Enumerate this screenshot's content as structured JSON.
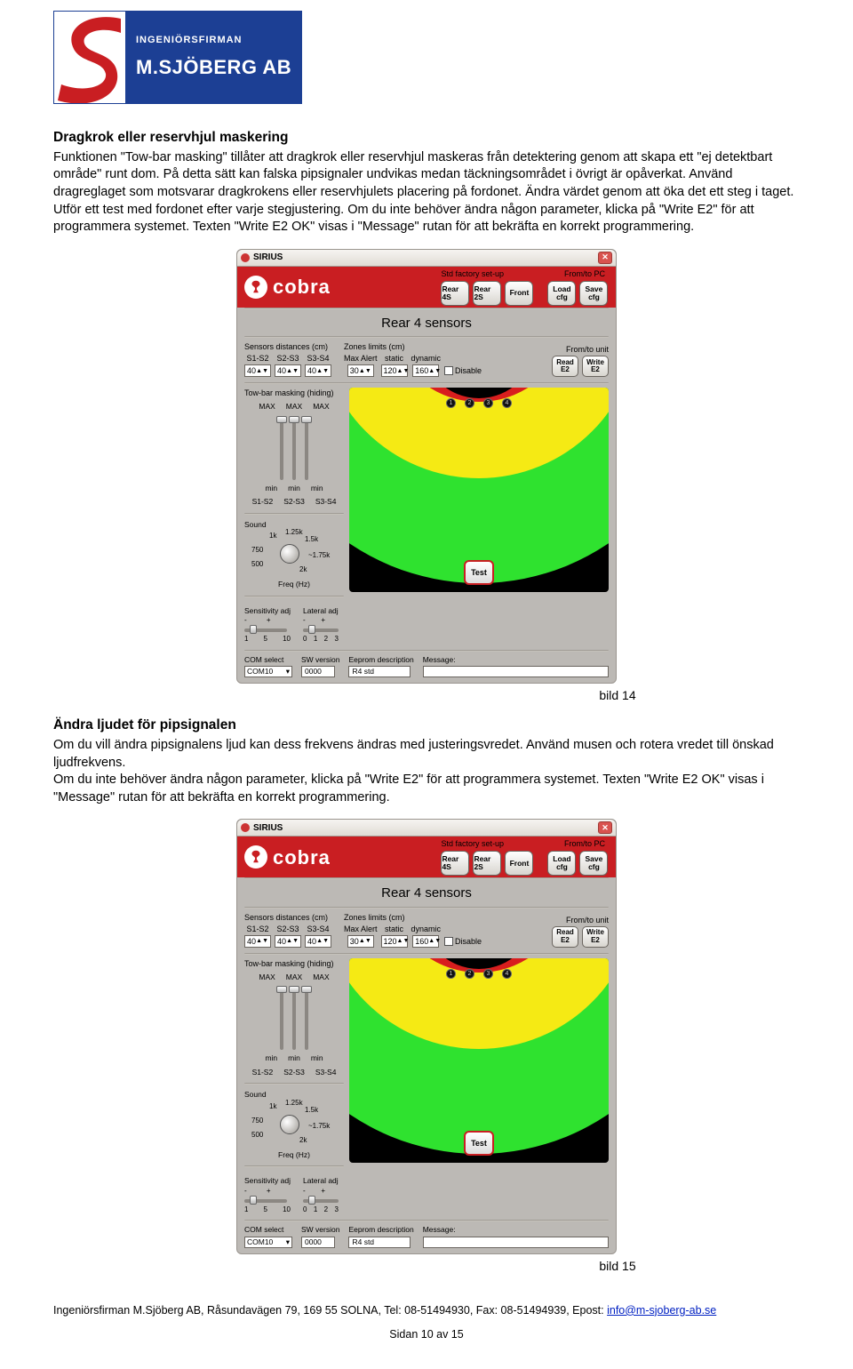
{
  "logo": {
    "small": "INGENIÖRSFIRMAN",
    "big": "M.SJÖBERG AB"
  },
  "sec1": {
    "head": "Dragkrok eller reservhjul maskering",
    "body": "Funktionen \"Tow-bar masking\" tillåter att dragkrok eller reservhjul maskeras från detektering genom att skapa ett \"ej detektbart område\" runt dom. På detta sätt kan falska pipsignaler undvikas medan täckningsområdet i övrigt är opåverkat. Använd dragreglaget som motsvarar dragkrokens eller reservhjulets placering på fordonet. Ändra värdet genom att öka det ett steg i taget. Utför ett test med fordonet efter varje stegjustering. Om du inte behöver ändra någon parameter, klicka på \"Write E2\" för att programmera systemet. Texten \"Write E2 OK\" visas i \"Message\" rutan för att bekräfta en korrekt programmering."
  },
  "caption1": "bild 14",
  "sec2": {
    "head": "Ändra ljudet för pipsignalen",
    "body1": "Om du vill ändra pipsignalens ljud kan dess frekvens ändras med justeringsvredet. Använd musen och rotera vredet till önskad ljudfrekvens.",
    "body2": "Om du inte behöver ändra någon parameter, klicka på \"Write E2\" för att programmera systemet. Texten \"Write E2 OK\" visas i \"Message\" rutan för att bekräfta en korrekt programmering."
  },
  "caption2": "bild 15",
  "app": {
    "title": "SIRIUS",
    "bannerLblLeft": "Std factory set-up",
    "bannerLblRight": "From/to PC",
    "btns": {
      "rear4s": "Rear 4S",
      "rear2s": "Rear 2S",
      "front": "Front",
      "loadcfg1": "Load",
      "loadcfg2": "cfg",
      "savecfg1": "Save",
      "savecfg2": "cfg"
    },
    "bigtitle": "Rear 4 sensors",
    "groups": {
      "dist": "Sensors distances (cm)",
      "zones": "Zones limits (cm)",
      "unit": "From/to unit"
    },
    "distCols": [
      "S1-S2",
      "S2-S3",
      "S3-S4"
    ],
    "distVals": [
      "40",
      "40",
      "40"
    ],
    "zoneCols": [
      "Max Alert",
      "static",
      "dynamic"
    ],
    "zoneVals": [
      "30",
      "120",
      "160"
    ],
    "disable": "Disable",
    "readE2a": "Read",
    "readE2b": "E2",
    "writeE2a": "Write",
    "writeE2b": "E2",
    "towbar": "Tow-bar masking (hiding)",
    "max": "MAX",
    "min": "min",
    "slCols": [
      "S1-S2",
      "S2-S3",
      "S3-S4"
    ],
    "sound": "Sound",
    "kl": {
      "k1": "1k",
      "k125": "1.25k",
      "k15": "1.5k",
      "k175": "~1.75k",
      "k2": "2k",
      "k750": "750",
      "k500": "500"
    },
    "freq": "Freq (Hz)",
    "sens": "Sensitivity adj",
    "lat": "Lateral adj",
    "sensScale": [
      "1",
      "5",
      "10"
    ],
    "latScale": [
      "0",
      "1",
      "2",
      "3"
    ],
    "test": "Test",
    "status": {
      "com": "COM select",
      "comv": "COM10",
      "sw": "SW version",
      "swv": "0000",
      "eep": "Eeprom description",
      "eepv": "R4 std",
      "msg": "Message:"
    }
  },
  "footer": {
    "line": "Ingeniörsfirman M.Sjöberg AB, Råsundavägen 79, 169 55  SOLNA, Tel: 08-51494930, Fax: 08-51494939, Epost: ",
    "email": "info@m-sjoberg-ab.se",
    "page": "Sidan 10 av 15"
  }
}
